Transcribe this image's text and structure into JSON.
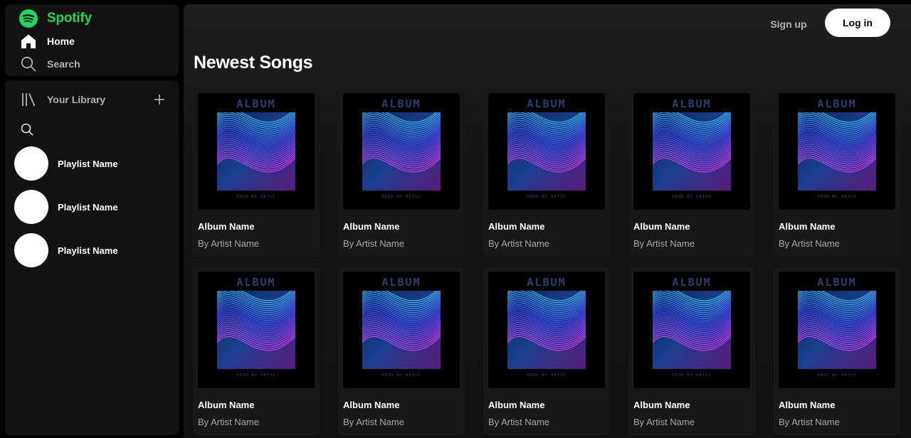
{
  "app": {
    "brand_name": "Spotify",
    "accent_color": "#1ed760"
  },
  "sidebar": {
    "nav": [
      {
        "label": "Home",
        "icon": "home-icon"
      },
      {
        "label": "Search",
        "icon": "search-icon"
      }
    ],
    "library": {
      "label": "Your Library",
      "icon": "library-icon",
      "add_icon": "plus-icon",
      "search_icon": "search-icon"
    },
    "playlists": [
      {
        "name": "Playlist Name"
      },
      {
        "name": "Playlist Name"
      },
      {
        "name": "Playlist Name"
      }
    ]
  },
  "header": {
    "signup_label": "Sign up",
    "login_label": "Log in"
  },
  "main": {
    "section_title": "Newest Songs",
    "cover_text": {
      "top": "ALBUM",
      "bottom": "PROD BY ARTSY"
    },
    "albums": [
      {
        "name": "Album Name",
        "artist": "By Artist Name"
      },
      {
        "name": "Album Name",
        "artist": "By Artist Name"
      },
      {
        "name": "Album Name",
        "artist": "By Artist Name"
      },
      {
        "name": "Album Name",
        "artist": "By Artist Name"
      },
      {
        "name": "Album Name",
        "artist": "By Artist Name"
      },
      {
        "name": "Album Name",
        "artist": "By Artist Name"
      },
      {
        "name": "Album Name",
        "artist": "By Artist Name"
      },
      {
        "name": "Album Name",
        "artist": "By Artist Name"
      },
      {
        "name": "Album Name",
        "artist": "By Artist Name"
      },
      {
        "name": "Album Name",
        "artist": "By Artist Name"
      }
    ]
  }
}
